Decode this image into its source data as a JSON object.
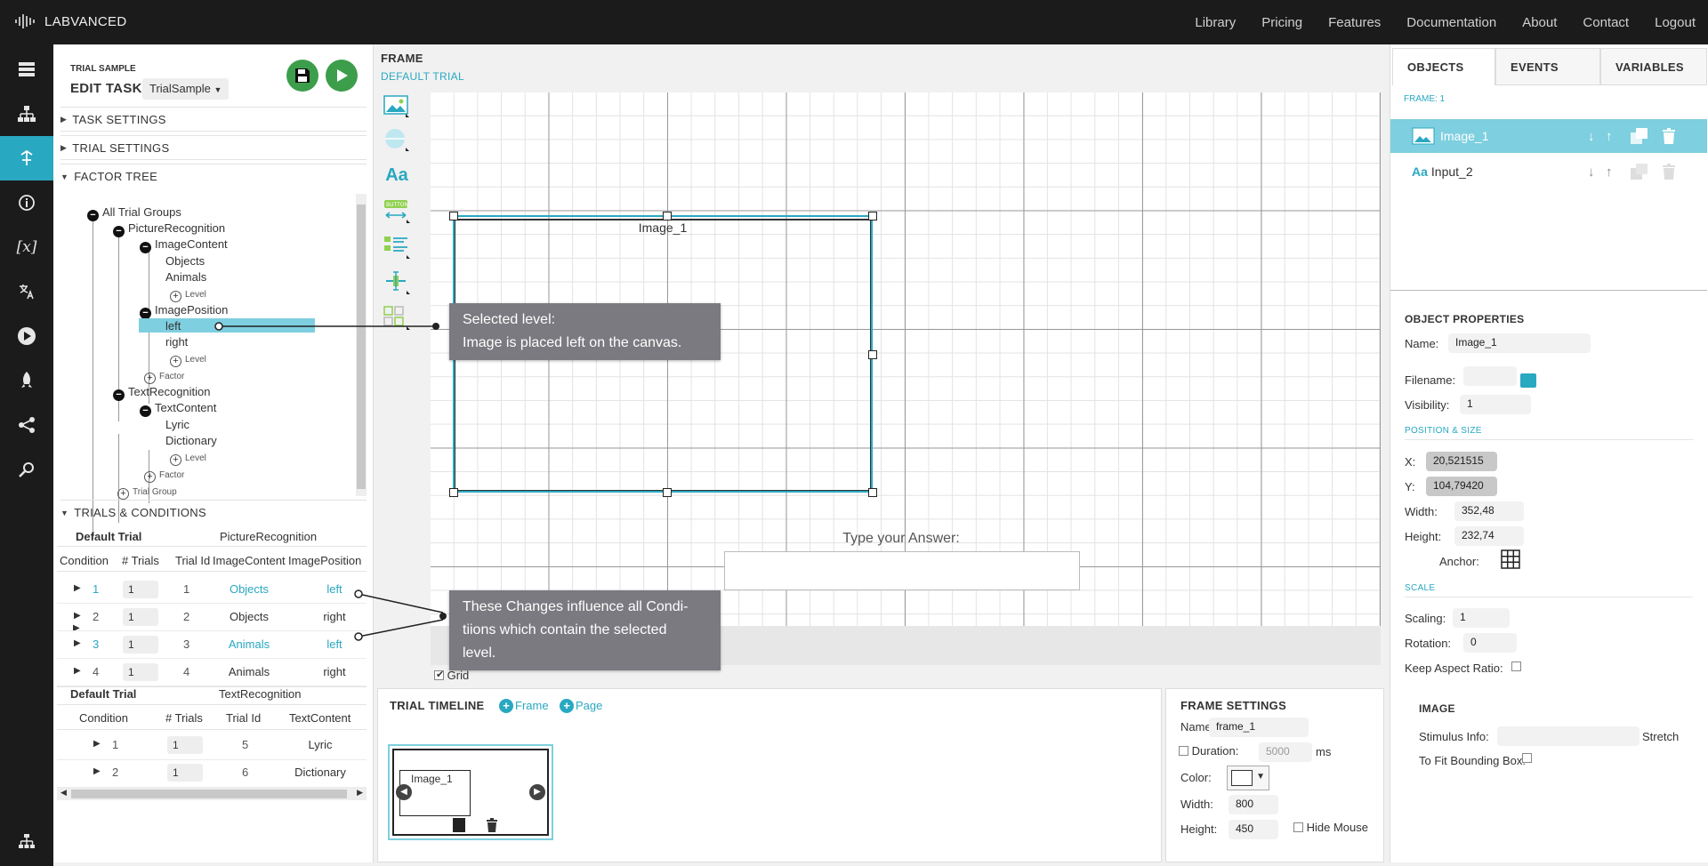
{
  "topbar": {
    "logo": "LABVANCED",
    "nav": [
      "Library",
      "Pricing",
      "Features",
      "Documentation",
      "About",
      "Contact",
      "Logout"
    ]
  },
  "leftbar": {
    "icons": [
      "studies-icon",
      "hierarchy-icon",
      "task-editor-icon",
      "info-icon",
      "variables-icon",
      "translate-icon",
      "play-icon",
      "publish-rocket-icon",
      "share-icon",
      "search-icon",
      "sitemap-icon"
    ]
  },
  "editor": {
    "trial_sample_label": "TRIAL SAMPLE",
    "edit_task_label": "EDIT TASK:",
    "task_select": "TrialSample"
  },
  "sections": {
    "task_settings": "TASK SETTINGS",
    "trial_settings": "TRIAL SETTINGS",
    "factor_tree": "FACTOR TREE",
    "trials_conditions": "TRIALS & CONDITIONS"
  },
  "tree": {
    "root": "All Trial Groups",
    "group1": "PictureRecognition",
    "factor1": "ImageContent",
    "f1_levels": [
      "Objects",
      "Animals"
    ],
    "level_label": "Level",
    "factor2": "ImagePosition",
    "f2_levels": [
      "left",
      "right"
    ],
    "factor_label": "Factor",
    "group2": "TextRecognition",
    "factor3": "TextContent",
    "f3_levels": [
      "Lyric",
      "Dictionary"
    ],
    "trial_group_label": "Trial Group"
  },
  "table1": {
    "trial": "Default Trial",
    "group": "PictureRecognition",
    "headers": [
      "Condition",
      "# Trials",
      "Trial Id",
      "ImageContent",
      "ImagePosition"
    ],
    "rows": [
      {
        "cond": "1",
        "trials": "1",
        "id": "1",
        "content": "Objects",
        "position": "left"
      },
      {
        "cond": "2",
        "trials": "1",
        "id": "2",
        "content": "Objects",
        "position": "right"
      },
      {
        "cond": "3",
        "trials": "1",
        "id": "3",
        "content": "Animals",
        "position": "left"
      },
      {
        "cond": "4",
        "trials": "1",
        "id": "4",
        "content": "Animals",
        "position": "right"
      }
    ]
  },
  "table2": {
    "trial": "Default Trial",
    "group": "TextRecognition",
    "headers": [
      "Condition",
      "# Trials",
      "Trial Id",
      "TextContent"
    ],
    "rows": [
      {
        "cond": "1",
        "trials": "1",
        "id": "5",
        "content": "Lyric"
      },
      {
        "cond": "2",
        "trials": "1",
        "id": "6",
        "content": "Dictionary"
      }
    ]
  },
  "frame": {
    "title": "FRAME",
    "subtitle": "DEFAULT TRIAL",
    "image_label": "Image_1",
    "answer_label": "Type your Answer:",
    "grid_label": "Grid"
  },
  "tooltips": {
    "t1_line1": "Selected level:",
    "t1_line2": "Image is placed left on the canvas.",
    "t2_line1": "These Changes influence all Condi-",
    "t2_line2": "tiions which contain the selected",
    "t2_line3": "level."
  },
  "timeline": {
    "title": "TRIAL TIMELINE",
    "add_frame": "Frame",
    "add_page": "Page",
    "thumb_label": "Image_1"
  },
  "frame_settings": {
    "title": "FRAME SETTINGS",
    "name_label": "Name:",
    "name_value": "frame_1",
    "duration_label": "Duration:",
    "duration_value": "5000",
    "duration_unit": "ms",
    "color_label": "Color:",
    "width_label": "Width:",
    "width_value": "800",
    "height_label": "Height:",
    "height_value": "450",
    "hide_mouse": "Hide Mouse"
  },
  "right": {
    "tabs": [
      "OBJECTS",
      "EVENTS",
      "VARIABLES"
    ],
    "frame_label": "FRAME: 1",
    "objects": [
      "Image_1",
      "Input_2"
    ],
    "props_title": "OBJECT PROPERTIES",
    "name_label": "Name:",
    "name_value": "Image_1",
    "filename_label": "Filename:",
    "visibility_label": "Visibility:",
    "visibility_value": "1",
    "pos_size": "POSITION & SIZE",
    "x_label": "X:",
    "x_value": "20,521515",
    "y_label": "Y:",
    "y_value": "104,79420",
    "width_label": "Width:",
    "width_value": "352,48",
    "height_label": "Height:",
    "height_value": "232,74",
    "anchor_label": "Anchor:",
    "scale": "SCALE",
    "scaling_label": "Scaling:",
    "scaling_value": "1",
    "rotation_label": "Rotation:",
    "rotation_value": "0",
    "aspect_label": "Keep Aspect Ratio:",
    "image_title": "IMAGE",
    "stimulus_label": "Stimulus Info:",
    "stretch_label": "Stretch",
    "fit_label": "To Fit Bounding Box:"
  },
  "colors": {
    "accent": "#29a8c1",
    "dark": "#1b1b1b",
    "tooltip": "#7a7a80"
  }
}
